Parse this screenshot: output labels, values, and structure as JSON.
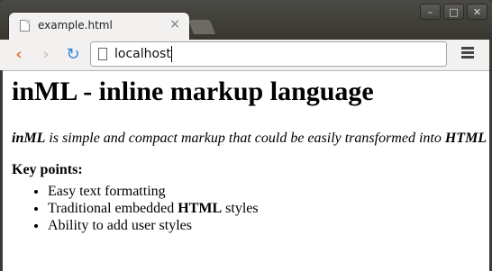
{
  "tab": {
    "title": "example.html",
    "close": "×"
  },
  "window_controls": {
    "minimize": "–",
    "maximize": "□",
    "close": "✕"
  },
  "nav": {
    "back": "‹",
    "forward": "›",
    "reload": "↻"
  },
  "address_bar": {
    "url": "localhost"
  },
  "page": {
    "heading": "inML - inline markup language",
    "description_start": "inML",
    "description_middle": " is simple and compact markup that could be easily transformed into ",
    "description_end": "HTML",
    "key_points_label": "Key points:",
    "points": [
      {
        "text": "Easy text formatting"
      },
      {
        "pre": "Traditional embedded ",
        "bold": "HTML",
        "post": " styles"
      },
      {
        "text": "Ability to add user styles"
      }
    ]
  },
  "colors": {
    "back_arrow": "#e07a3c",
    "reload": "#3a86d6",
    "forward_disabled": "#c9c8c6"
  }
}
